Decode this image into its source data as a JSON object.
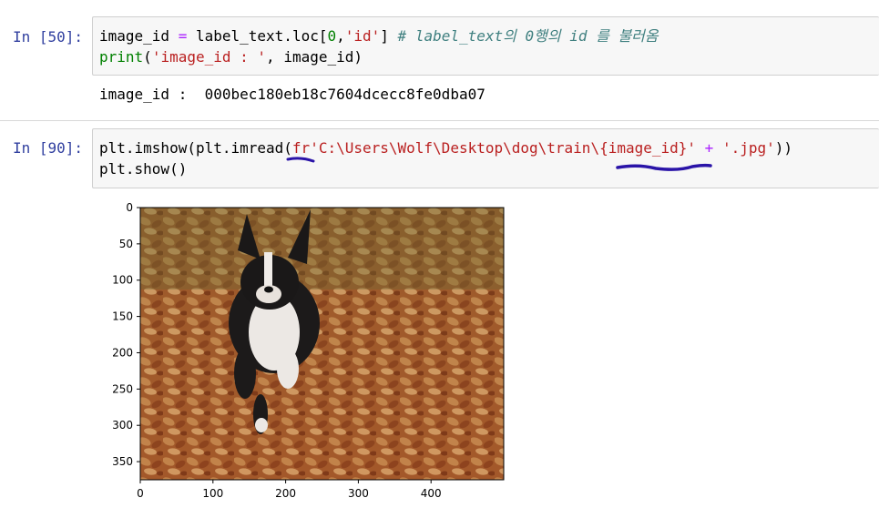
{
  "cell1": {
    "prompt": "In [50]:",
    "line1": {
      "var": "image_id ",
      "eq": "=",
      "expr_a": " label_text.loc[",
      "num": "0",
      "comma": ",",
      "str": "'id'",
      "close": "] ",
      "comment": "# label_text의 0행의 id 를 불러옴"
    },
    "line2": {
      "func": "print",
      "open": "(",
      "str": "'image_id : '",
      "rest": ", image_id)"
    },
    "output": "image_id :  000bec180eb18c7604dcecc8fe0dba07"
  },
  "cell2": {
    "prompt": "In [90]:",
    "line1": {
      "prefix": "plt.imshow(plt.imread(",
      "fstr_a": "fr'C:\\Users\\Wolf\\Desktop\\dog\\train\\",
      "fstr_b": "{image_id}",
      "fstr_c": "'",
      "plus": " + ",
      "str2": "'.jpg'",
      "suffix": "))"
    },
    "line2": "plt.show()"
  },
  "plot": {
    "x_ticks": [
      "0",
      "100",
      "200",
      "300",
      "400"
    ],
    "y_ticks": [
      "0",
      "50",
      "100",
      "150",
      "200",
      "250",
      "300",
      "350"
    ]
  },
  "colors": {
    "prompt": "#303f9f",
    "annotation": "#1a0dab",
    "input_bg": "#f7f7f7"
  }
}
